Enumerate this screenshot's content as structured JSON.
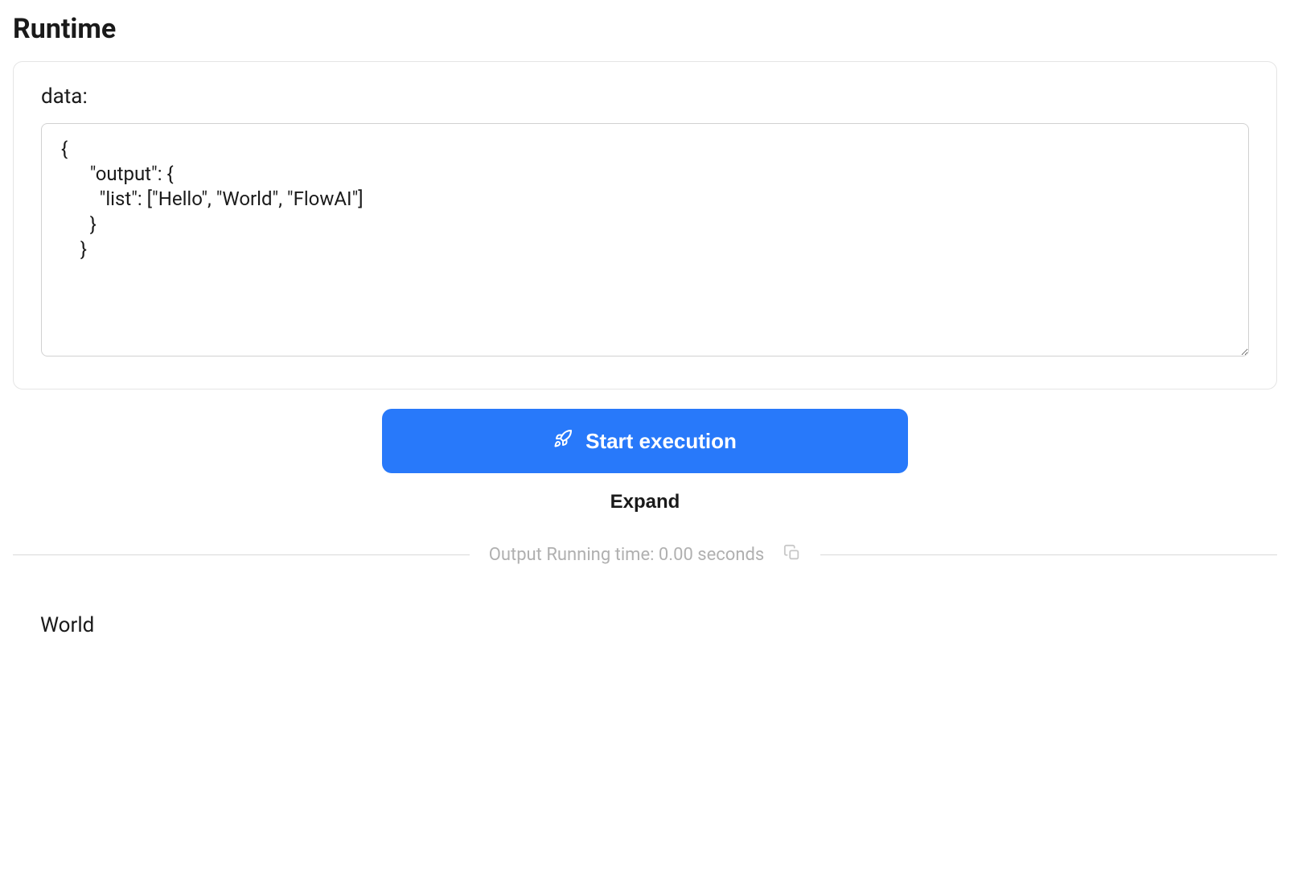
{
  "header": {
    "title": "Runtime"
  },
  "panel": {
    "label": "data:",
    "textarea_value": "{\n      \"output\": {\n        \"list\": [\"Hello\", \"World\", \"FlowAI\"]\n      }\n    }"
  },
  "actions": {
    "start_label": "Start execution",
    "expand_label": "Expand"
  },
  "divider": {
    "text": "Output Running time: 0.00 seconds"
  },
  "output": {
    "value": "World"
  }
}
